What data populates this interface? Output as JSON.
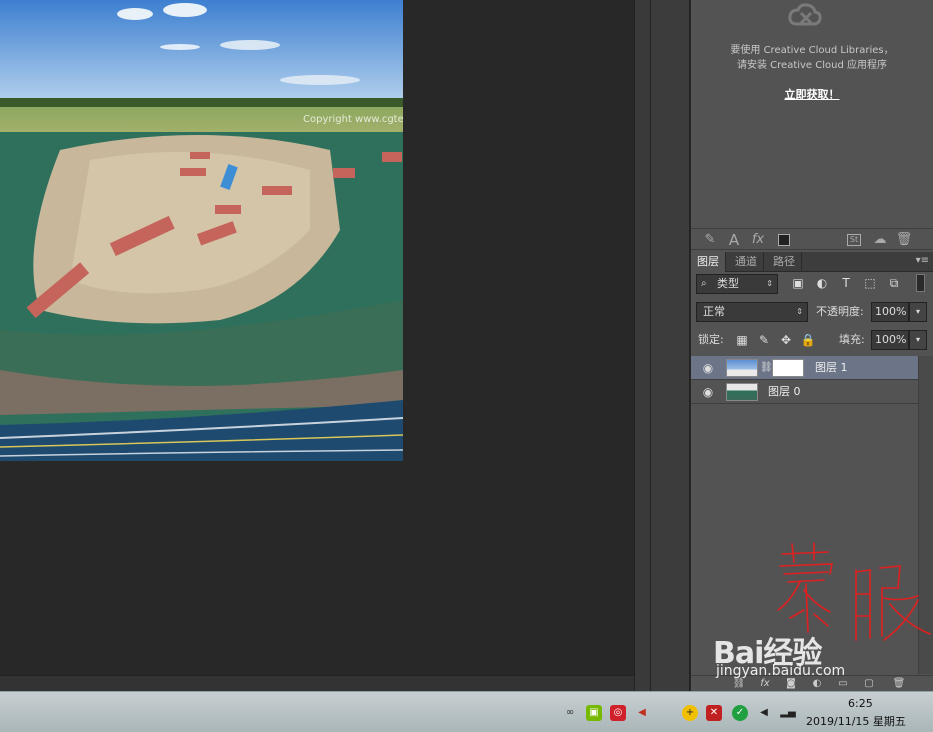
{
  "canvas": {
    "copyright_text": "Copyright www.cgtex"
  },
  "creative_cloud": {
    "line1": "要使用 Creative Cloud Libraries，",
    "line2": "请安装 Creative Cloud 应用程序",
    "link": "立即获取！"
  },
  "library_toolbar": {
    "icons": [
      "brush-icon",
      "text-a-icon",
      "fx-icon",
      "color-swatch-icon",
      "stock-st-icon",
      "cc-sync-icon",
      "trash-icon"
    ]
  },
  "layers_panel": {
    "tabs": [
      "图层",
      "通道",
      "路径"
    ],
    "active_tab": "图层",
    "filter_type": "类型",
    "blend_mode": "正常",
    "opacity_label": "不透明度:",
    "opacity_value": "100%",
    "lock_label": "锁定:",
    "fill_label": "填充:",
    "fill_value": "100%",
    "layers": [
      {
        "name": "图层 1",
        "selected": true,
        "has_mask": true
      },
      {
        "name": "图层 0",
        "selected": false,
        "has_mask": false
      }
    ]
  },
  "annotation": {
    "handwriting": "蒙版"
  },
  "watermark": {
    "brand": "Bai经验",
    "domain": "jingyan.baidu.com"
  },
  "taskbar": {
    "time": "6:25",
    "date": "2019/11/15 星期五"
  }
}
